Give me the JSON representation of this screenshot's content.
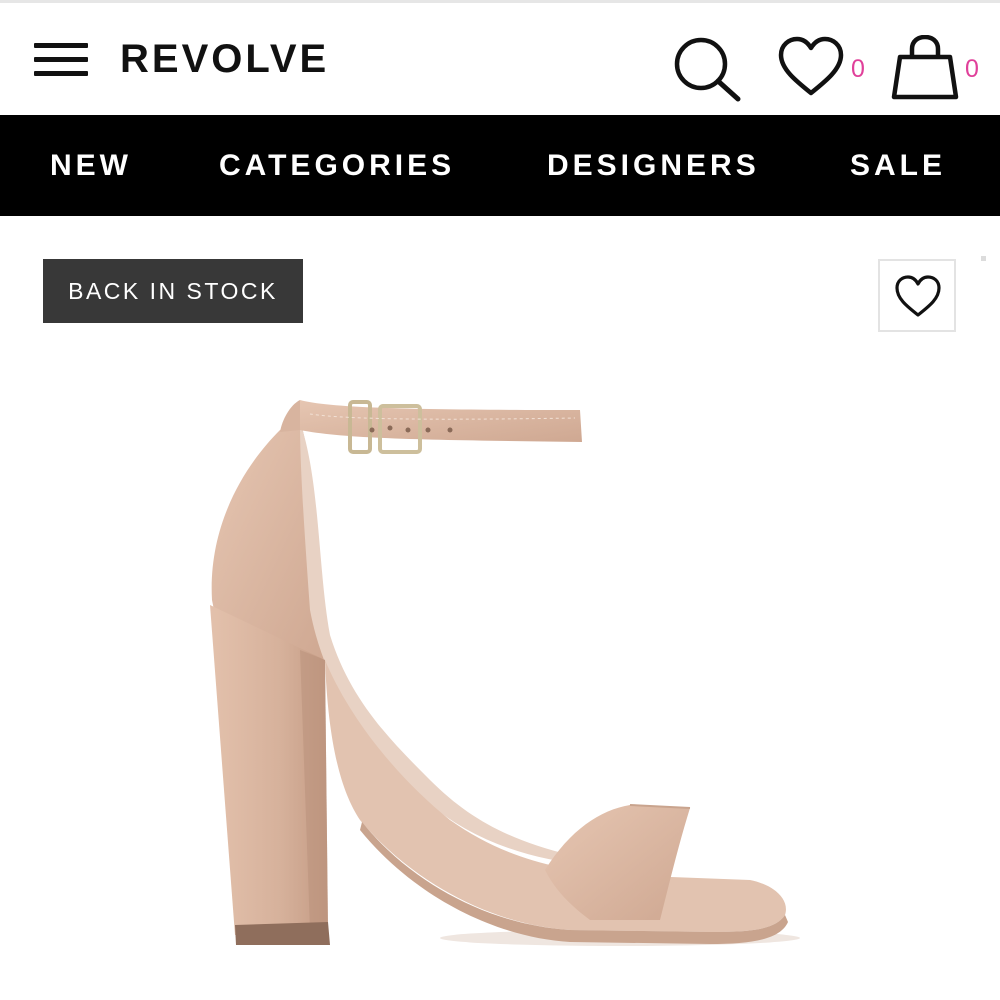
{
  "header": {
    "logo": "REVOLVE",
    "wishlist_count": "0",
    "bag_count": "0",
    "icons": [
      "menu-icon",
      "search-icon",
      "heart-icon",
      "shopping-bag-icon"
    ]
  },
  "nav": {
    "items": [
      {
        "label": "NEW"
      },
      {
        "label": "CATEGORIES"
      },
      {
        "label": "DESIGNERS"
      },
      {
        "label": "SALE"
      }
    ]
  },
  "product": {
    "badge": "BACK IN STOCK",
    "image_alt": "nude suede block heel ankle strap sandal",
    "favorite_icon": "heart-outline-icon"
  },
  "colors": {
    "brand_black": "#000000",
    "count_pink": "#e0409a",
    "badge_bg": "#383838",
    "sandal_suede": "#dcb9a3"
  }
}
